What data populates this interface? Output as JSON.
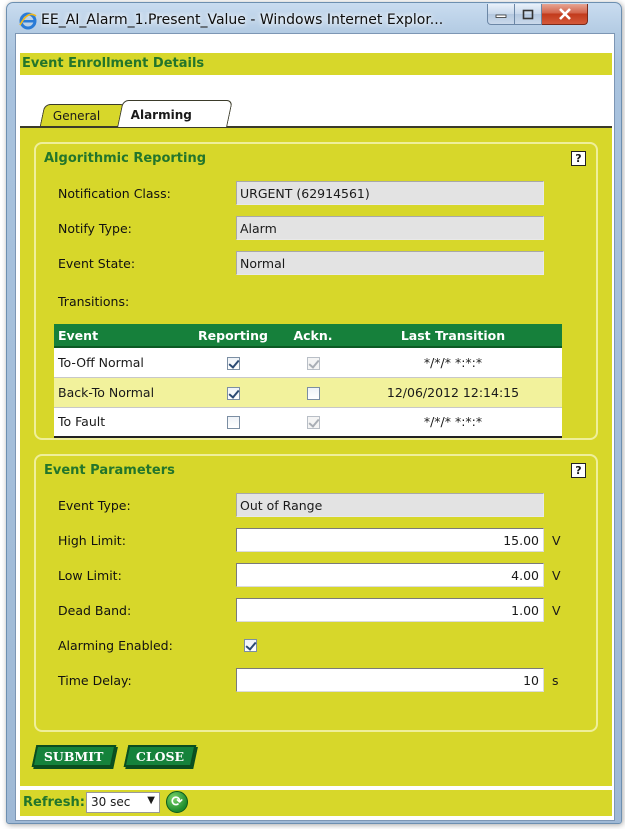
{
  "window": {
    "title": "EE_AI_Alarm_1.Present_Value - Windows Internet Explor..."
  },
  "header": {
    "title": "Event Enrollment Details"
  },
  "tabs": [
    {
      "label": "General",
      "active": false
    },
    {
      "label": "Alarming",
      "active": true
    }
  ],
  "algorithmic_reporting": {
    "title": "Algorithmic Reporting",
    "help": "?",
    "notification_class_label": "Notification Class:",
    "notification_class_value": "URGENT (62914561)",
    "notify_type_label": "Notify Type:",
    "notify_type_value": "Alarm",
    "event_state_label": "Event State:",
    "event_state_value": "Normal",
    "transitions_label": "Transitions:",
    "columns": [
      "Event",
      "Reporting",
      "Ackn.",
      "Last Transition"
    ],
    "rows": [
      {
        "event": "To-Off Normal",
        "reporting": true,
        "ackn": true,
        "ackn_enabled": false,
        "last": "*/*/* *:*:*"
      },
      {
        "event": "Back-To Normal",
        "reporting": true,
        "ackn": false,
        "ackn_enabled": true,
        "last": "12/06/2012 12:14:15"
      },
      {
        "event": "To Fault",
        "reporting": false,
        "ackn": true,
        "ackn_enabled": false,
        "last": "*/*/* *:*:*"
      }
    ]
  },
  "event_parameters": {
    "title": "Event Parameters",
    "help": "?",
    "event_type_label": "Event Type:",
    "event_type_value": "Out of Range",
    "high_limit_label": "High Limit:",
    "high_limit_value": "15.00",
    "high_limit_unit": "V",
    "low_limit_label": "Low Limit:",
    "low_limit_value": "4.00",
    "low_limit_unit": "V",
    "dead_band_label": "Dead Band:",
    "dead_band_value": "1.00",
    "dead_band_unit": "V",
    "alarming_enabled_label": "Alarming Enabled:",
    "alarming_enabled": true,
    "time_delay_label": "Time Delay:",
    "time_delay_value": "10",
    "time_delay_unit": "s"
  },
  "actions": {
    "submit_label": "SUBMIT",
    "close_label": "CLOSE"
  },
  "refresh": {
    "label": "Refresh:",
    "selected": "30 sec"
  },
  "colors": {
    "panel": "#d7d72a",
    "header_text": "#23752b",
    "table_header": "#16803b",
    "highlight_row": "#f2f29c"
  }
}
